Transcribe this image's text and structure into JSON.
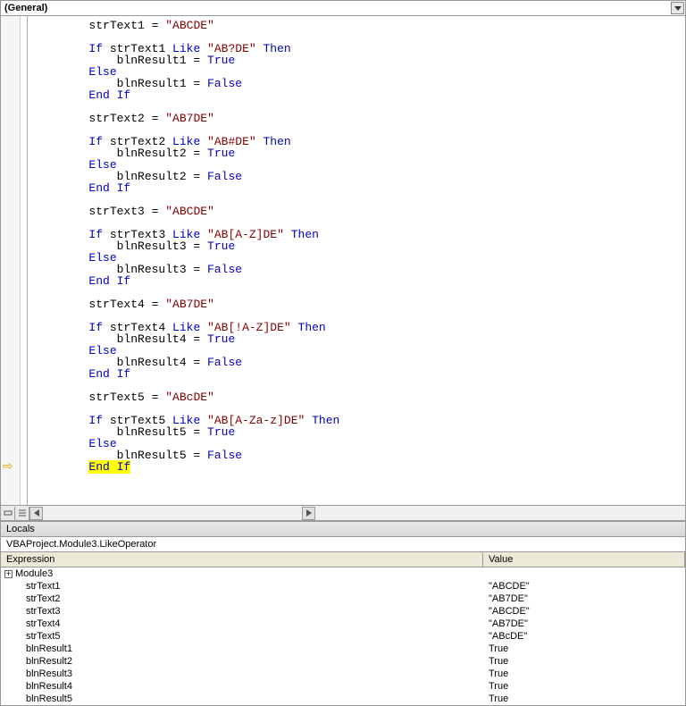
{
  "dropdown": {
    "selected": "(General)"
  },
  "code": {
    "lines": [
      {
        "indent": 2,
        "tokens": [
          {
            "t": "strText1 = "
          },
          {
            "t": "\"ABCDE\"",
            "c": "str"
          }
        ]
      },
      {
        "indent": 0,
        "tokens": []
      },
      {
        "indent": 2,
        "tokens": [
          {
            "t": "If",
            "c": "kw"
          },
          {
            "t": " strText1 "
          },
          {
            "t": "Like",
            "c": "kw"
          },
          {
            "t": " "
          },
          {
            "t": "\"AB?DE\"",
            "c": "str"
          },
          {
            "t": " "
          },
          {
            "t": "Then",
            "c": "kw"
          }
        ]
      },
      {
        "indent": 3,
        "tokens": [
          {
            "t": "blnResult1 = "
          },
          {
            "t": "True",
            "c": "kw"
          }
        ]
      },
      {
        "indent": 2,
        "tokens": [
          {
            "t": "Else",
            "c": "kw"
          }
        ]
      },
      {
        "indent": 3,
        "tokens": [
          {
            "t": "blnResult1 = "
          },
          {
            "t": "False",
            "c": "kw"
          }
        ]
      },
      {
        "indent": 2,
        "tokens": [
          {
            "t": "End If",
            "c": "kw"
          }
        ]
      },
      {
        "indent": 0,
        "tokens": []
      },
      {
        "indent": 2,
        "tokens": [
          {
            "t": "strText2 = "
          },
          {
            "t": "\"AB7DE\"",
            "c": "str"
          }
        ]
      },
      {
        "indent": 0,
        "tokens": []
      },
      {
        "indent": 2,
        "tokens": [
          {
            "t": "If",
            "c": "kw"
          },
          {
            "t": " strText2 "
          },
          {
            "t": "Like",
            "c": "kw"
          },
          {
            "t": " "
          },
          {
            "t": "\"AB#DE\"",
            "c": "str"
          },
          {
            "t": " "
          },
          {
            "t": "Then",
            "c": "kw"
          }
        ]
      },
      {
        "indent": 3,
        "tokens": [
          {
            "t": "blnResult2 = "
          },
          {
            "t": "True",
            "c": "kw"
          }
        ]
      },
      {
        "indent": 2,
        "tokens": [
          {
            "t": "Else",
            "c": "kw"
          }
        ]
      },
      {
        "indent": 3,
        "tokens": [
          {
            "t": "blnResult2 = "
          },
          {
            "t": "False",
            "c": "kw"
          }
        ]
      },
      {
        "indent": 2,
        "tokens": [
          {
            "t": "End If",
            "c": "kw"
          }
        ]
      },
      {
        "indent": 0,
        "tokens": []
      },
      {
        "indent": 2,
        "tokens": [
          {
            "t": "strText3 = "
          },
          {
            "t": "\"ABCDE\"",
            "c": "str"
          }
        ]
      },
      {
        "indent": 0,
        "tokens": []
      },
      {
        "indent": 2,
        "tokens": [
          {
            "t": "If",
            "c": "kw"
          },
          {
            "t": " strText3 "
          },
          {
            "t": "Like",
            "c": "kw"
          },
          {
            "t": " "
          },
          {
            "t": "\"AB[A-Z]DE\"",
            "c": "str"
          },
          {
            "t": " "
          },
          {
            "t": "Then",
            "c": "kw"
          }
        ]
      },
      {
        "indent": 3,
        "tokens": [
          {
            "t": "blnResult3 = "
          },
          {
            "t": "True",
            "c": "kw"
          }
        ]
      },
      {
        "indent": 2,
        "tokens": [
          {
            "t": "Else",
            "c": "kw"
          }
        ]
      },
      {
        "indent": 3,
        "tokens": [
          {
            "t": "blnResult3 = "
          },
          {
            "t": "False",
            "c": "kw"
          }
        ]
      },
      {
        "indent": 2,
        "tokens": [
          {
            "t": "End If",
            "c": "kw"
          }
        ]
      },
      {
        "indent": 0,
        "tokens": []
      },
      {
        "indent": 2,
        "tokens": [
          {
            "t": "strText4 = "
          },
          {
            "t": "\"AB7DE\"",
            "c": "str"
          }
        ]
      },
      {
        "indent": 0,
        "tokens": []
      },
      {
        "indent": 2,
        "tokens": [
          {
            "t": "If",
            "c": "kw"
          },
          {
            "t": " strText4 "
          },
          {
            "t": "Like",
            "c": "kw"
          },
          {
            "t": " "
          },
          {
            "t": "\"AB[!A-Z]DE\"",
            "c": "str"
          },
          {
            "t": " "
          },
          {
            "t": "Then",
            "c": "kw"
          }
        ]
      },
      {
        "indent": 3,
        "tokens": [
          {
            "t": "blnResult4 = "
          },
          {
            "t": "True",
            "c": "kw"
          }
        ]
      },
      {
        "indent": 2,
        "tokens": [
          {
            "t": "Else",
            "c": "kw"
          }
        ]
      },
      {
        "indent": 3,
        "tokens": [
          {
            "t": "blnResult4 = "
          },
          {
            "t": "False",
            "c": "kw"
          }
        ]
      },
      {
        "indent": 2,
        "tokens": [
          {
            "t": "End If",
            "c": "kw"
          }
        ]
      },
      {
        "indent": 0,
        "tokens": []
      },
      {
        "indent": 2,
        "tokens": [
          {
            "t": "strText5 = "
          },
          {
            "t": "\"ABcDE\"",
            "c": "str"
          }
        ]
      },
      {
        "indent": 0,
        "tokens": []
      },
      {
        "indent": 2,
        "tokens": [
          {
            "t": "If",
            "c": "kw"
          },
          {
            "t": " strText5 "
          },
          {
            "t": "Like",
            "c": "kw"
          },
          {
            "t": " "
          },
          {
            "t": "\"AB[A-Za-z]DE\"",
            "c": "str"
          },
          {
            "t": " "
          },
          {
            "t": "Then",
            "c": "kw"
          }
        ]
      },
      {
        "indent": 3,
        "tokens": [
          {
            "t": "blnResult5 = "
          },
          {
            "t": "True",
            "c": "kw"
          }
        ]
      },
      {
        "indent": 2,
        "tokens": [
          {
            "t": "Else",
            "c": "kw"
          }
        ]
      },
      {
        "indent": 3,
        "tokens": [
          {
            "t": "blnResult5 = "
          },
          {
            "t": "False",
            "c": "kw"
          }
        ]
      },
      {
        "indent": 2,
        "tokens": [
          {
            "t": "End If",
            "c": "kw"
          }
        ],
        "highlight": true,
        "marker": true
      }
    ]
  },
  "locals": {
    "title": "Locals",
    "context": "VBAProject.Module3.LikeOperator",
    "headers": {
      "expression": "Expression",
      "value": "Value"
    },
    "root": {
      "name": "Module3",
      "expandable": true
    },
    "vars": [
      {
        "name": "strText1",
        "value": "\"ABCDE\""
      },
      {
        "name": "strText2",
        "value": "\"AB7DE\""
      },
      {
        "name": "strText3",
        "value": "\"ABCDE\""
      },
      {
        "name": "strText4",
        "value": "\"AB7DE\""
      },
      {
        "name": "strText5",
        "value": "\"ABcDE\""
      },
      {
        "name": "blnResult1",
        "value": "True"
      },
      {
        "name": "blnResult2",
        "value": "True"
      },
      {
        "name": "blnResult3",
        "value": "True"
      },
      {
        "name": "blnResult4",
        "value": "True"
      },
      {
        "name": "blnResult5",
        "value": "True"
      }
    ]
  }
}
